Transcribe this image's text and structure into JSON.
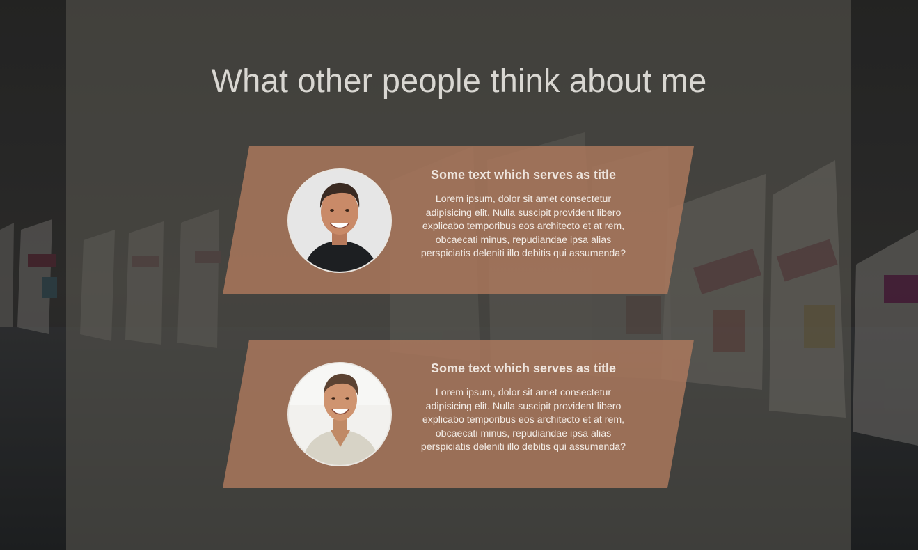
{
  "section": {
    "heading": "What other people think about me"
  },
  "testimonials": [
    {
      "title": "Some text which serves as title",
      "text": "Lorem ipsum, dolor sit amet consectetur adipisicing elit. Nulla suscipit provident libero explicabo temporibus eos architecto et at rem, obcaecati minus, repudiandae ipsa alias perspiciatis deleniti illo debitis qui assumenda?",
      "avatar": "person-smiling-dark-shirt"
    },
    {
      "title": "Some text which serves as title",
      "text": "Lorem ipsum, dolor sit amet consectetur adipisicing elit. Nulla suscipit provident libero explicabo temporibus eos architecto et at rem, obcaecati minus, repudiandae ipsa alias perspiciatis deleniti illo debitis qui assumenda?",
      "avatar": "person-smiling-light-shirt"
    }
  ],
  "colors": {
    "card": "#b07a5e",
    "heading": "#d9d7d2",
    "overlay": "#4a4842"
  }
}
